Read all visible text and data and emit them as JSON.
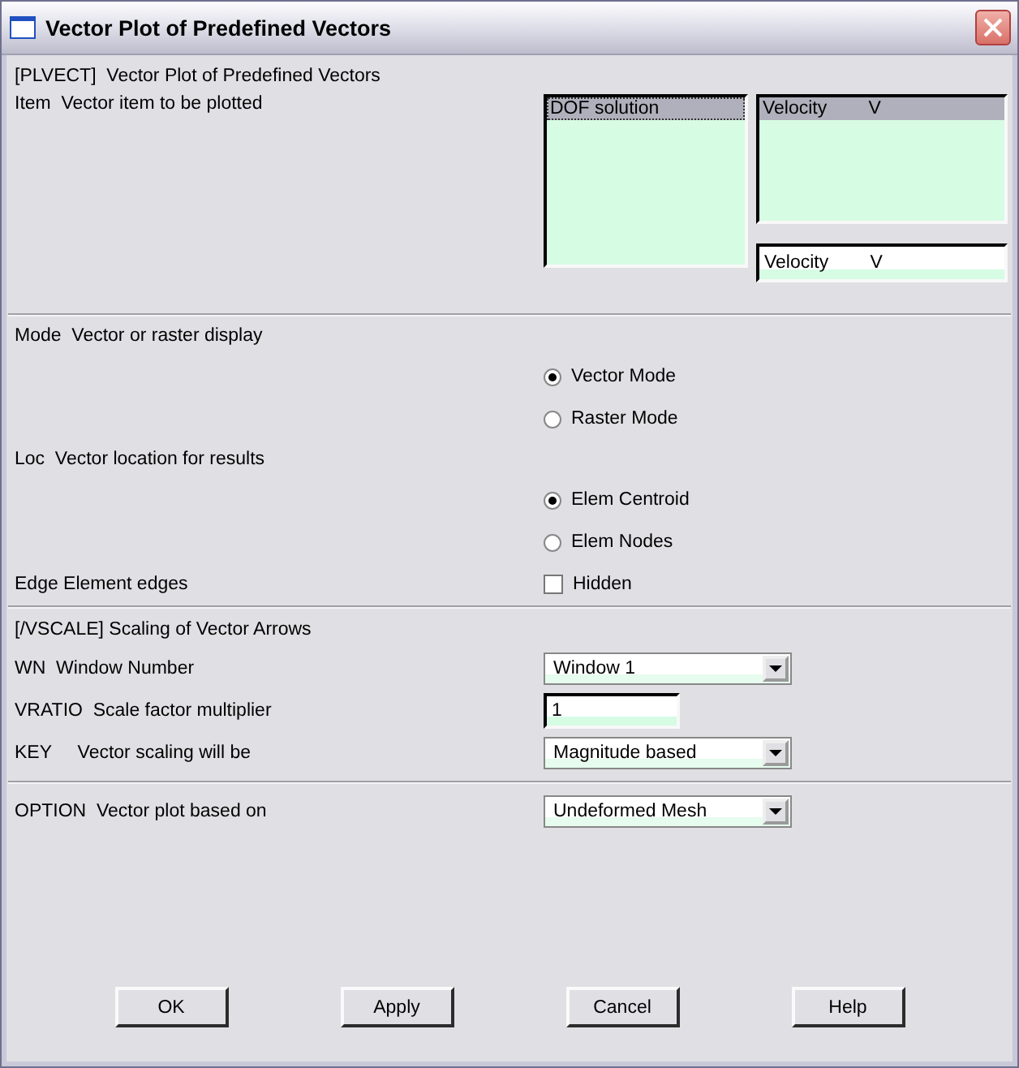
{
  "window": {
    "title": "Vector Plot of Predefined Vectors"
  },
  "plvect": {
    "heading": "[PLVECT]  Vector Plot of Predefined Vectors",
    "item": {
      "label": "Item  Vector item to be plotted",
      "categories": [
        {
          "label": "DOF solution",
          "selected": true
        }
      ],
      "components": [
        {
          "label": "Velocity        V",
          "selected": true
        }
      ],
      "value": "Velocity        V"
    },
    "mode": {
      "label": "Mode  Vector or raster display",
      "options": [
        {
          "label": "Vector Mode",
          "selected": true
        },
        {
          "label": "Raster Mode",
          "selected": false
        }
      ]
    },
    "loc": {
      "label": "Loc  Vector location for results",
      "options": [
        {
          "label": "Elem Centroid",
          "selected": true
        },
        {
          "label": "Elem Nodes",
          "selected": false
        }
      ]
    },
    "edge": {
      "label": "Edge Element edges",
      "option": "Hidden",
      "checked": false
    }
  },
  "vscale": {
    "heading": "[/VSCALE] Scaling of Vector Arrows",
    "wn": {
      "label": "WN  Window Number",
      "value": "Window 1"
    },
    "vratio": {
      "label": "VRATIO  Scale factor multiplier",
      "value": "1"
    },
    "key": {
      "label": "KEY     Vector scaling will be",
      "value": "Magnitude based"
    }
  },
  "option": {
    "label": "OPTION  Vector plot based on",
    "value": "Undeformed Mesh"
  },
  "buttons": [
    "OK",
    "Apply",
    "Cancel",
    "Help"
  ]
}
